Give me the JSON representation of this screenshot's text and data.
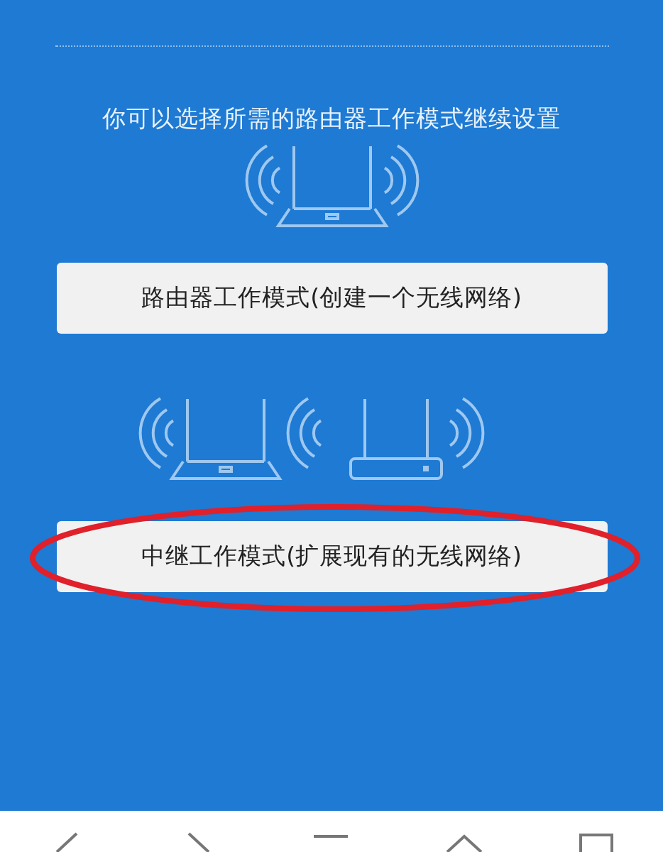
{
  "prompt": "你可以选择所需的路由器工作模式继续设置",
  "modes": [
    {
      "kind": "single",
      "label": "路由器工作模式(创建一个无线网络)",
      "circled": false
    },
    {
      "kind": "pair",
      "label": "中继工作模式(扩展现有的无线网络)",
      "circled": true
    }
  ]
}
